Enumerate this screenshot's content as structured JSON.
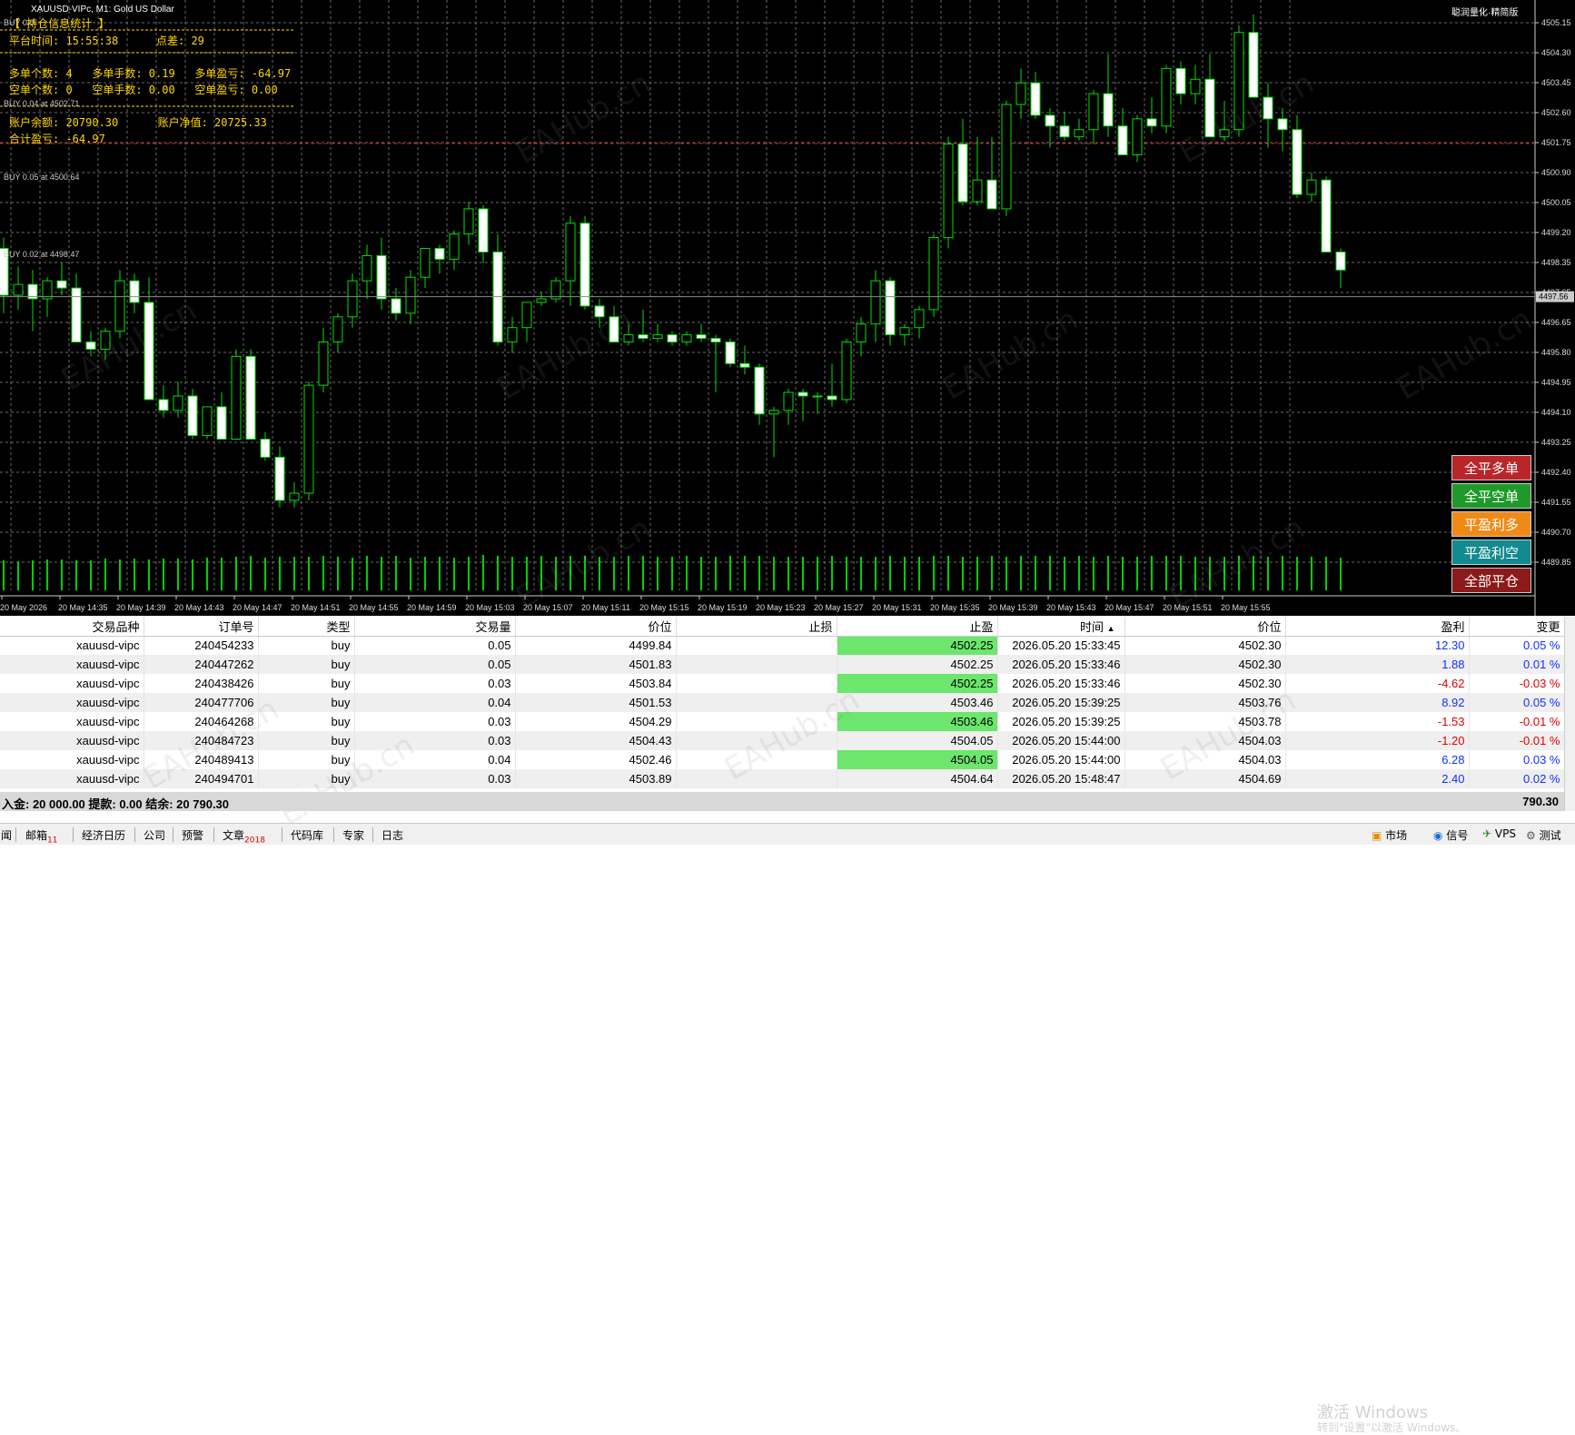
{
  "window": {
    "title": "XAUUSD-VIPc, M1:  Gold US Dollar",
    "top_right": "聪润量化·精简版"
  },
  "stats": {
    "header": "【 持仓信息统计 】",
    "platform_time": "平台时间: 15:55:38",
    "spread": "点差: 29",
    "buy_line": "多单个数: 4   多单手数: 0.19   多单盈亏: -64.97",
    "sell_line": "空单个数: 0   空单手数: 0.00   空单盈亏: 0.00",
    "balance_line": "账户余额: 20790.30      账户净值: 20725.33",
    "total_pl": "合计盈亏: -64.97"
  },
  "position_labels": [
    "BUY 0.0",
    "BUY 0.04 at 4502.71",
    "BUY 0.05 at 4500.64",
    "BUY 0.02 at 4498.47"
  ],
  "side_buttons": [
    {
      "label": "全平多单",
      "color": "#b8262a"
    },
    {
      "label": "全平空单",
      "color": "#1f9a2a"
    },
    {
      "label": "平盈利多",
      "color": "#f08a17"
    },
    {
      "label": "平盈利空",
      "color": "#138a8f"
    },
    {
      "label": "全部平仓",
      "color": "#8b1a1a"
    }
  ],
  "chart_data": {
    "type": "candlestick",
    "symbol": "XAUUSD-VIPc",
    "timeframe": "M1",
    "current_price": "4497.56",
    "price_axis": [
      "4505.15",
      "4504.30",
      "4503.45",
      "4502.60",
      "4501.75",
      "4500.90",
      "4500.05",
      "4499.20",
      "4498.35",
      "4497.65",
      "4496.65",
      "4495.80",
      "4494.95",
      "4494.10",
      "4493.25",
      "4492.40",
      "4491.55",
      "4490.70",
      "4489.85"
    ],
    "ylim": [
      4489.4,
      4505.6
    ],
    "time_axis": [
      "20 May 2026",
      "20 May 14:35",
      "20 May 14:39",
      "20 May 14:43",
      "20 May 14:47",
      "20 May 14:51",
      "20 May 14:55",
      "20 May 14:59",
      "20 May 15:03",
      "20 May 15:07",
      "20 May 15:11",
      "20 May 15:15",
      "20 May 15:19",
      "20 May 15:23",
      "20 May 15:27",
      "20 May 15:31",
      "20 May 15:35",
      "20 May 15:39",
      "20 May 15:43",
      "20 May 15:47",
      "20 May 15:51",
      "20 May 15:55"
    ],
    "candles": [
      [
        4498.9,
        4499.2,
        4497.1,
        4497.6
      ],
      [
        4497.6,
        4498.4,
        4497.2,
        4497.9
      ],
      [
        4497.9,
        4498.3,
        4496.6,
        4497.5
      ],
      [
        4497.5,
        4498.1,
        4497.0,
        4498.0
      ],
      [
        4498.0,
        4498.5,
        4497.6,
        4497.8
      ],
      [
        4497.8,
        4498.2,
        4496.3,
        4496.3
      ],
      [
        4496.3,
        4496.6,
        4495.9,
        4496.1
      ],
      [
        4496.1,
        4496.7,
        4495.8,
        4496.6
      ],
      [
        4496.6,
        4498.3,
        4496.4,
        4498.0
      ],
      [
        4498.0,
        4498.2,
        4497.1,
        4497.4
      ],
      [
        4497.4,
        4498.1,
        4494.7,
        4494.7
      ],
      [
        4494.7,
        4495.1,
        4494.2,
        4494.4
      ],
      [
        4494.4,
        4495.2,
        4494.2,
        4494.8
      ],
      [
        4494.8,
        4495.0,
        4493.6,
        4493.7
      ],
      [
        4493.7,
        4494.5,
        4493.6,
        4494.5
      ],
      [
        4494.5,
        4494.9,
        4493.6,
        4493.6
      ],
      [
        4493.6,
        4496.1,
        4493.6,
        4495.9
      ],
      [
        4495.9,
        4496.1,
        4493.6,
        4493.6
      ],
      [
        4493.6,
        4493.8,
        4493.0,
        4493.1
      ],
      [
        4493.1,
        4493.4,
        4491.7,
        4491.9
      ],
      [
        4491.9,
        4492.4,
        4491.7,
        4492.1
      ],
      [
        4492.1,
        4495.2,
        4491.9,
        4495.1
      ],
      [
        4495.1,
        4496.7,
        4494.9,
        4496.3
      ],
      [
        4496.3,
        4497.1,
        4496.0,
        4497.0
      ],
      [
        4497.0,
        4498.2,
        4496.7,
        4498.0
      ],
      [
        4498.0,
        4499.0,
        4497.5,
        4498.7
      ],
      [
        4498.7,
        4499.2,
        4497.2,
        4497.5
      ],
      [
        4497.5,
        4497.8,
        4496.9,
        4497.1
      ],
      [
        4497.1,
        4498.3,
        4496.8,
        4498.1
      ],
      [
        4498.1,
        4498.8,
        4497.8,
        4498.9
      ],
      [
        4498.9,
        4499.0,
        4498.2,
        4498.6
      ],
      [
        4498.6,
        4499.4,
        4498.3,
        4499.3
      ],
      [
        4499.3,
        4500.2,
        4499.0,
        4500.0
      ],
      [
        4500.0,
        4500.1,
        4498.5,
        4498.8
      ],
      [
        4498.8,
        4499.3,
        4496.2,
        4496.3
      ],
      [
        4496.3,
        4497.0,
        4496.0,
        4496.7
      ],
      [
        4496.7,
        4497.2,
        4496.3,
        4497.4
      ],
      [
        4497.4,
        4497.7,
        4497.3,
        4497.5
      ],
      [
        4497.5,
        4498.1,
        4497.4,
        4498.0
      ],
      [
        4498.0,
        4499.8,
        4497.3,
        4499.6
      ],
      [
        4499.6,
        4499.8,
        4497.2,
        4497.3
      ],
      [
        4497.3,
        4497.5,
        4496.7,
        4497.0
      ],
      [
        4497.0,
        4497.3,
        4496.3,
        4496.3
      ],
      [
        4496.3,
        4496.8,
        4496.2,
        4496.5
      ],
      [
        4496.5,
        4497.2,
        4496.3,
        4496.4
      ],
      [
        4496.4,
        4496.8,
        4496.3,
        4496.5
      ],
      [
        4496.5,
        4496.6,
        4496.2,
        4496.3
      ],
      [
        4496.3,
        4496.6,
        4496.2,
        4496.5
      ],
      [
        4496.5,
        4496.8,
        4496.3,
        4496.4
      ],
      [
        4496.4,
        4496.5,
        4494.9,
        4496.3
      ],
      [
        4496.3,
        4496.4,
        4495.6,
        4495.7
      ],
      [
        4495.7,
        4496.2,
        4495.4,
        4495.6
      ],
      [
        4495.6,
        4495.7,
        4494.0,
        4494.3
      ],
      [
        4494.3,
        4494.5,
        4493.1,
        4494.4
      ],
      [
        4494.4,
        4495.0,
        4494.0,
        4494.9
      ],
      [
        4494.9,
        4495.0,
        4494.1,
        4494.8
      ],
      [
        4494.8,
        4494.9,
        4494.3,
        4494.8
      ],
      [
        4494.8,
        4495.7,
        4494.5,
        4494.7
      ],
      [
        4494.7,
        4496.4,
        4494.6,
        4496.3
      ],
      [
        4496.3,
        4497.0,
        4495.9,
        4496.8
      ],
      [
        4496.8,
        4498.3,
        4496.3,
        4498.0
      ],
      [
        4498.0,
        4498.1,
        4496.2,
        4496.5
      ],
      [
        4496.5,
        4496.8,
        4496.2,
        4496.7
      ],
      [
        4496.7,
        4497.3,
        4496.4,
        4497.2
      ],
      [
        4497.2,
        4499.3,
        4497.0,
        4499.2
      ],
      [
        4499.2,
        4502.0,
        4498.9,
        4501.8
      ],
      [
        4501.8,
        4502.5,
        4500.1,
        4500.2
      ],
      [
        4500.2,
        4502.0,
        4500.1,
        4500.8
      ],
      [
        4500.8,
        4502.0,
        4500.4,
        4500.0
      ],
      [
        4500.0,
        4503.0,
        4499.8,
        4502.9
      ],
      [
        4502.9,
        4503.9,
        4502.5,
        4503.5
      ],
      [
        4503.5,
        4503.8,
        4502.5,
        4502.6
      ],
      [
        4502.6,
        4502.8,
        4501.7,
        4502.3
      ],
      [
        4502.3,
        4502.7,
        4501.9,
        4502.0
      ],
      [
        4502.0,
        4502.5,
        4501.9,
        4502.2
      ],
      [
        4502.2,
        4503.3,
        4501.8,
        4503.2
      ],
      [
        4503.2,
        4504.3,
        4502.0,
        4502.3
      ],
      [
        4502.3,
        4502.8,
        4501.6,
        4501.5
      ],
      [
        4501.5,
        4502.6,
        4501.3,
        4502.5
      ],
      [
        4502.5,
        4503.1,
        4502.1,
        4502.3
      ],
      [
        4502.3,
        4504.0,
        4502.1,
        4503.9
      ],
      [
        4503.9,
        4504.1,
        4502.9,
        4503.2
      ],
      [
        4503.2,
        4504.0,
        4502.9,
        4503.6
      ],
      [
        4503.6,
        4504.3,
        4502.0,
        4502.0
      ],
      [
        4502.0,
        4503.0,
        4501.9,
        4502.2
      ],
      [
        4502.2,
        4505.1,
        4502.0,
        4504.9
      ],
      [
        4504.9,
        4505.4,
        4503.2,
        4503.1
      ],
      [
        4503.1,
        4503.5,
        4501.7,
        4502.5
      ],
      [
        4502.5,
        4502.8,
        4501.6,
        4502.2
      ],
      [
        4502.2,
        4502.6,
        4500.3,
        4500.4
      ],
      [
        4500.4,
        4501.0,
        4500.2,
        4500.8
      ],
      [
        4500.8,
        4500.9,
        4498.8,
        4498.8
      ],
      [
        4498.8,
        4498.9,
        4497.8,
        4498.3
      ]
    ],
    "volume_bars": [
      33,
      32,
      33,
      34,
      34,
      33,
      33,
      35,
      34,
      35,
      34,
      35,
      35,
      34,
      36,
      36,
      37,
      38,
      36,
      37,
      37,
      37,
      38,
      37,
      36,
      38,
      37,
      38,
      36,
      37,
      37,
      36,
      37,
      39,
      38,
      37,
      37,
      38,
      37,
      38,
      38,
      37,
      37,
      38,
      38,
      37,
      37,
      38,
      37,
      37,
      38,
      38,
      38,
      37,
      37,
      37,
      37,
      38,
      37,
      37,
      37,
      38,
      37,
      37,
      38,
      38,
      37,
      37,
      38,
      37,
      38,
      38,
      38,
      37,
      38,
      37,
      38,
      37,
      37,
      38,
      38,
      38,
      37,
      37,
      37,
      38,
      38,
      37,
      38,
      37,
      37,
      37,
      36
    ]
  },
  "table": {
    "columns": [
      "交易品种",
      "订单号",
      "类型",
      "交易量",
      "价位",
      "止损",
      "止盈",
      "时间",
      "价位",
      "盈利",
      "变更"
    ],
    "sort_indicator": "▲",
    "rows": [
      [
        "xauusd-vipc",
        "240454233",
        "buy",
        "0.05",
        "4499.84",
        "",
        "4502.25",
        "2026.05.20 15:33:45",
        "4502.30",
        "12.30",
        "0.05 %"
      ],
      [
        "xauusd-vipc",
        "240447262",
        "buy",
        "0.05",
        "4501.83",
        "",
        "4502.25",
        "2026.05.20 15:33:46",
        "4502.30",
        "1.88",
        "0.01 %"
      ],
      [
        "xauusd-vipc",
        "240438426",
        "buy",
        "0.03",
        "4503.84",
        "",
        "4502.25",
        "2026.05.20 15:33:46",
        "4502.30",
        "-4.62",
        "-0.03 %"
      ],
      [
        "xauusd-vipc",
        "240477706",
        "buy",
        "0.04",
        "4501.53",
        "",
        "4503.46",
        "2026.05.20 15:39:25",
        "4503.76",
        "8.92",
        "0.05 %"
      ],
      [
        "xauusd-vipc",
        "240464268",
        "buy",
        "0.03",
        "4504.29",
        "",
        "4503.46",
        "2026.05.20 15:39:25",
        "4503.78",
        "-1.53",
        "-0.01 %"
      ],
      [
        "xauusd-vipc",
        "240484723",
        "buy",
        "0.03",
        "4504.43",
        "",
        "4504.05",
        "2026.05.20 15:44:00",
        "4504.03",
        "-1.20",
        "-0.01 %"
      ],
      [
        "xauusd-vipc",
        "240489413",
        "buy",
        "0.04",
        "4502.46",
        "",
        "4504.05",
        "2026.05.20 15:44:00",
        "4504.03",
        "6.28",
        "0.03 %"
      ],
      [
        "xauusd-vipc",
        "240494701",
        "buy",
        "0.03",
        "4503.89",
        "",
        "4504.64",
        "2026.05.20 15:48:47",
        "4504.69",
        "2.40",
        "0.02 %"
      ]
    ],
    "summary": "入金: 20 000.00  提款: 0.00  结余: 20 790.30",
    "summary_total": "790.30"
  },
  "windows_activation": {
    "title": "激活 Windows",
    "subtitle": "转到\"设置\"以激活 Windows。"
  },
  "status_bar": {
    "tabs": [
      {
        "label": "闻",
        "badge": ""
      },
      {
        "label": "邮箱",
        "badge": "11"
      },
      {
        "label": "经济日历",
        "badge": ""
      },
      {
        "label": "公司",
        "badge": ""
      },
      {
        "label": "预警",
        "badge": ""
      },
      {
        "label": "文章",
        "badge": "2018"
      },
      {
        "label": "代码库",
        "badge": ""
      },
      {
        "label": "专家",
        "badge": ""
      },
      {
        "label": "日志",
        "badge": ""
      }
    ],
    "right": [
      "市场",
      "信号",
      "VPS",
      "测试"
    ]
  },
  "watermark": "EAHub.cn",
  "colors": {
    "up_body": "#000000",
    "up_border": "#00e000",
    "down_body": "#ffffff",
    "down_border": "#00e000",
    "grid": "#6a6a6a",
    "volume": "#00d000",
    "bid_line": "#8a8a8a",
    "sl_line": "#cc2222",
    "tp_cell": "#6ce66c",
    "profit_pos": "#1030ff",
    "profit_neg": "#e00000"
  }
}
